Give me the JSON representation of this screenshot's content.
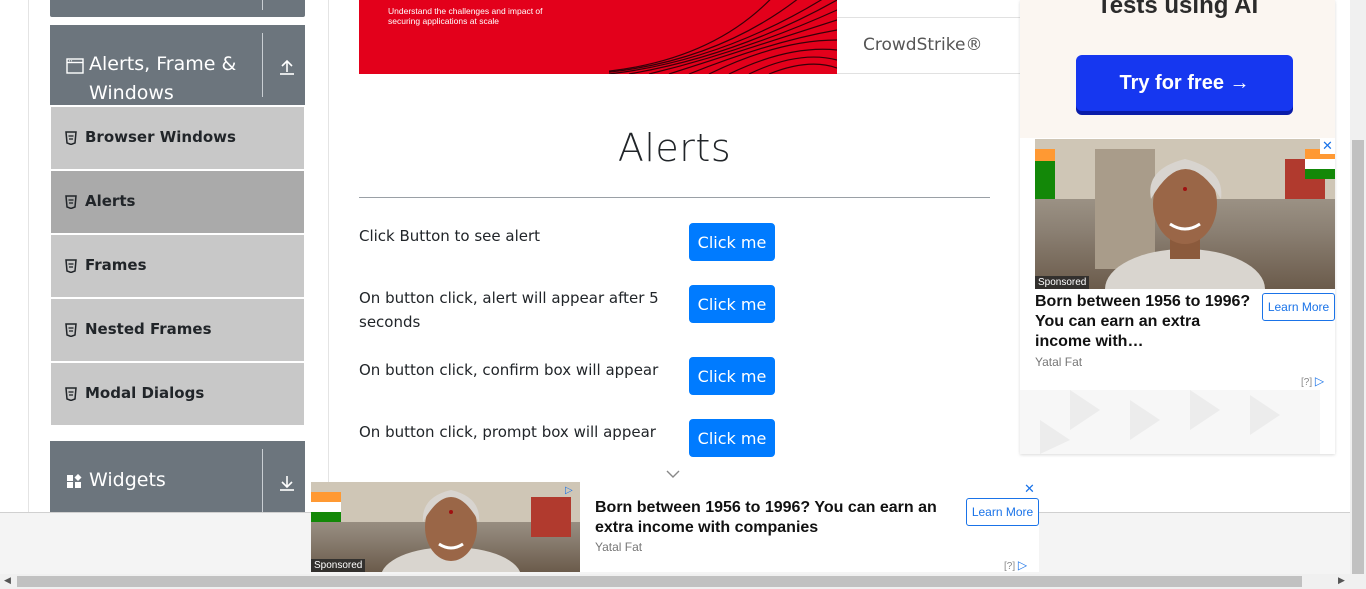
{
  "sidebar": {
    "groups": [
      {
        "label": "Alerts, Frame & Windows",
        "icon": "window-icon",
        "toggle_icon": "arrow-up-icon"
      },
      {
        "label": "Widgets",
        "icon": "widgets-icon",
        "toggle_icon": "arrow-down-icon"
      }
    ],
    "items": [
      {
        "label": "Browser Windows",
        "active": false
      },
      {
        "label": "Alerts",
        "active": true
      },
      {
        "label": "Frames",
        "active": false
      },
      {
        "label": "Nested Frames",
        "active": false
      },
      {
        "label": "Modal Dialogs",
        "active": false
      }
    ]
  },
  "top_banner": {
    "tagline_line1": "Understand the challenges and impact of",
    "tagline_line2": "securing applications at scale",
    "brand": "CrowdStrike®"
  },
  "main": {
    "title": "Alerts",
    "rows": [
      {
        "text": "Click Button to see alert",
        "button": "Click me"
      },
      {
        "text": "On button click, alert will appear after 5 seconds",
        "button": "Click me"
      },
      {
        "text": "On button click, confirm box will appear",
        "button": "Click me"
      },
      {
        "text": "On button click, prompt box will appear",
        "button": "Click me"
      }
    ]
  },
  "right_ad": {
    "top_title": "Tests using AI",
    "cta": "Try for free →",
    "sponsored": "Sponsored",
    "close": "✕",
    "headline": "Born between 1956 to 1996? You can earn an extra income with…",
    "learn_more": "Learn More",
    "advertiser": "Yatal Fat",
    "adchoice": "[?]"
  },
  "bottom_ad": {
    "sponsored": "Sponsored",
    "close": "✕",
    "headline": "Born between 1956 to 1996? You can earn an extra income with companies",
    "learn_more": "Learn More",
    "advertiser": "Yatal Fat",
    "adchoice": "[?]"
  },
  "colors": {
    "sidebar_header": "#6c757d",
    "menu_item": "#c8c8c8",
    "menu_item_active": "#aaaaaa",
    "primary_button": "#007bff",
    "banner_red": "#e3001b",
    "cta_blue": "#1637f0"
  }
}
